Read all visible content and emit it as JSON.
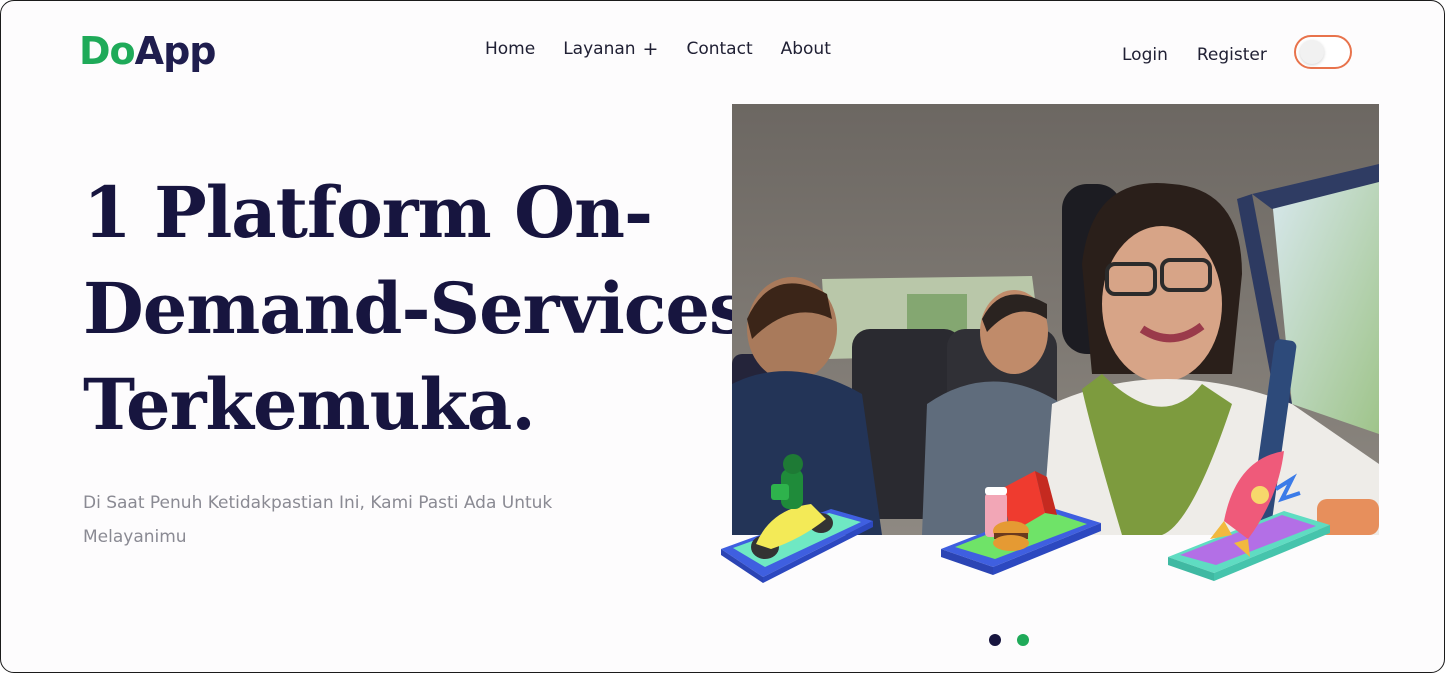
{
  "brand": {
    "part1": "Do",
    "part2": "App"
  },
  "nav": {
    "items": [
      {
        "label": "Home"
      },
      {
        "label": "Layanan",
        "has_plus": true
      },
      {
        "label": "Contact"
      },
      {
        "label": "About"
      }
    ],
    "login": "Login",
    "register": "Register"
  },
  "theme_toggle": {
    "state": "off",
    "accent_color": "#e8734c"
  },
  "hero": {
    "headline_lines": [
      "1 Platform On-",
      "Demand-Services",
      "Terkemuka."
    ],
    "subtitle_line1": "Di Saat Penuh Ketidakpastian Ini, Kami Pasti Ada Untuk",
    "subtitle_line2": "Melayanimu"
  },
  "services": [
    "scooter-delivery-icon",
    "food-delivery-icon",
    "rocket-icon"
  ],
  "carousel": {
    "slides": 2,
    "active_index": 0
  },
  "colors": {
    "brand_green": "#1faa59",
    "brand_navy": "#1f1d4e",
    "headline": "#17153f",
    "subtitle": "#8a8a93"
  }
}
